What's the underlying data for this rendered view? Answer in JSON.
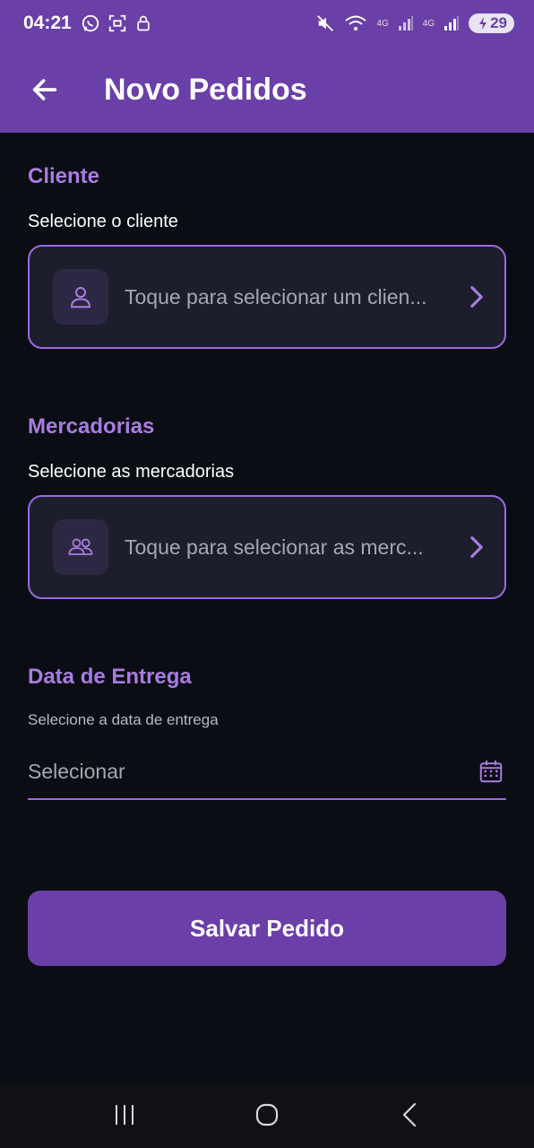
{
  "status_bar": {
    "time": "04:21",
    "network_left": "4G",
    "network_right": "4G",
    "battery": "29",
    "left_icons": [
      "whatsapp-icon",
      "screenshot-icon",
      "lock-icon"
    ],
    "right_icons": [
      "mute-icon",
      "wifi-icon",
      "signal-icon",
      "signal-icon",
      "battery-icon"
    ]
  },
  "app_bar": {
    "title": "Novo Pedidos",
    "back_icon": "arrow-left-icon"
  },
  "cliente": {
    "title": "Cliente",
    "subtitle": "Selecione o cliente",
    "placeholder": "Toque para selecionar um clien...",
    "icon": "person-icon"
  },
  "mercadorias": {
    "title": "Mercadorias",
    "subtitle": "Selecione as mercadorias",
    "placeholder": "Toque para selecionar as merc...",
    "icon": "people-icon"
  },
  "entrega": {
    "title": "Data de Entrega",
    "label": "Selecione a data de entrega",
    "value": "Selecionar",
    "icon": "calendar-icon"
  },
  "actions": {
    "save_label": "Salvar Pedido"
  },
  "colors": {
    "primary": "#6b3fa8",
    "accent": "#a97ce0",
    "background": "#0a0d14",
    "card": "#1c1f2b"
  }
}
